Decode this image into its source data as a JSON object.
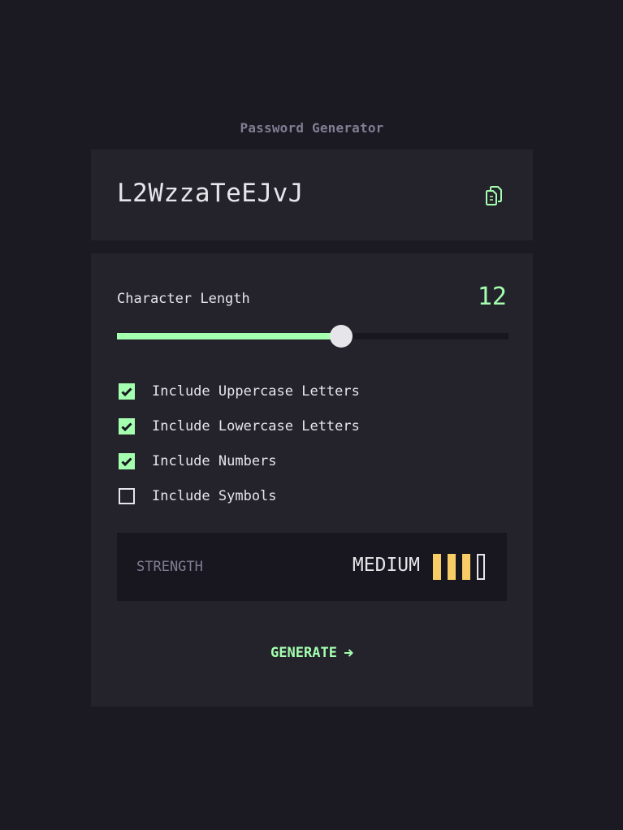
{
  "header": {
    "title": "Password Generator"
  },
  "password": {
    "value": "L2WzzaTeEJvJ",
    "copy_icon": "copy-icon"
  },
  "length": {
    "label": "Character Length",
    "value": "12",
    "fraction": 0.572
  },
  "options": [
    {
      "label": "Include Uppercase Letters",
      "checked": true
    },
    {
      "label": "Include Lowercase Letters",
      "checked": true
    },
    {
      "label": "Include Numbers",
      "checked": true
    },
    {
      "label": "Include Symbols",
      "checked": false
    }
  ],
  "strength": {
    "label": "STRENGTH",
    "value": "MEDIUM",
    "level": 3,
    "max_level": 4
  },
  "generate": {
    "label": "GENERATE",
    "icon": "arrow-right-icon"
  },
  "colors": {
    "background": "#1b1a23",
    "panel": "#24232c",
    "accent": "#a4ffaf",
    "strength_medium": "#f8cd65",
    "text": "#e6e5ea",
    "muted": "#817d92"
  }
}
